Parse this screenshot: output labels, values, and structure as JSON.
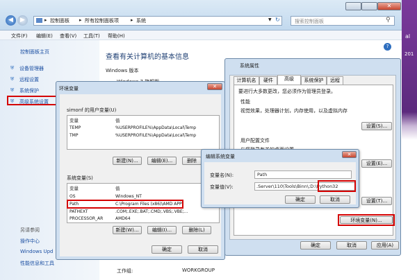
{
  "explorer": {
    "breadcrumb": [
      "控制面板",
      "所有控制面板项",
      "系统"
    ],
    "search_placeholder": "搜索控制面板",
    "menu": [
      "文件(F)",
      "编辑(E)",
      "查看(V)",
      "工具(T)",
      "帮助(H)"
    ],
    "sidebar_home": "控制面板主页",
    "sidebar_links": [
      "设备管理器",
      "远程设置",
      "系统保护",
      "高级系统设置"
    ],
    "see_also_header": "另请参阅",
    "see_also": [
      "操作中心",
      "Windows Upd",
      "性能信息和工具"
    ],
    "heading": "查看有关计算机的基本信息",
    "edition_label": "Windows 版本",
    "edition_value": "Windows 7 旗舰版",
    "workgroup_label": "工作组:",
    "workgroup_value": "WORKGROUP",
    "edge_text": "al",
    "edge_number": "201"
  },
  "sysprops": {
    "title": "系统属性",
    "tabs": [
      "计算机名",
      "硬件",
      "高级",
      "系统保护",
      "远程"
    ],
    "admin_note": "要进行大多数更改，您必须作为管理员登录。",
    "perf_title": "性能",
    "perf_desc": "视觉效果，处理器计划，内存使用，以及虚拟内存",
    "settings_btn": "设置(S)...",
    "profile_title": "用户配置文件",
    "profile_desc": "与您登录有关的桌面设置",
    "settings_btn2": "设置(E)...",
    "settings_btn3": "设置(T)...",
    "env_btn": "环境变量(N)...",
    "ok": "确定",
    "cancel": "取消",
    "apply": "应用(A)"
  },
  "envvars": {
    "title": "环境变量",
    "user_group": "simonf 的用户变量(U)",
    "col_var": "变量",
    "col_val": "值",
    "user_rows": [
      {
        "name": "TEMP",
        "value": "%USERPROFILE%\\AppData\\Local\\Temp"
      },
      {
        "name": "TMP",
        "value": "%USERPROFILE%\\AppData\\Local\\Temp"
      }
    ],
    "new_btn": "新建(N)...",
    "edit_btn": "编辑(E)...",
    "delete_btn": "删除",
    "sys_group": "系统变量(S)",
    "sys_rows": [
      {
        "name": "OS",
        "value": "Windows_NT"
      },
      {
        "name": "Path",
        "value": "C:\\Program Files (x86)\\AMD APP\\"
      },
      {
        "name": "PATHEXT",
        "value": ".COM;.EXE;.BAT;.CMD;.VBS;.VBE;..."
      },
      {
        "name": "PROCESSOR_AR",
        "value": "AMD64"
      }
    ],
    "new_btn2": "新建(W)...",
    "edit_btn2": "编辑(I)...",
    "delete_btn2": "删除(L)",
    "ok": "确定",
    "cancel": "取消"
  },
  "editvar": {
    "title": "编辑系统变量",
    "name_label": "变量名(N):",
    "name_value": "Path",
    "value_label": "变量值(V):",
    "value_text": ".Server\\110\\Tools\\Binn\\",
    "value_highlight": ";D:\\Python32",
    "ok": "确定",
    "cancel": "取消"
  },
  "colors": {
    "chrome_blue": "#c9dff2",
    "link_blue": "#1b4fa2",
    "highlight_red": "#d40000",
    "accent_purple": "#6a2c8c"
  }
}
